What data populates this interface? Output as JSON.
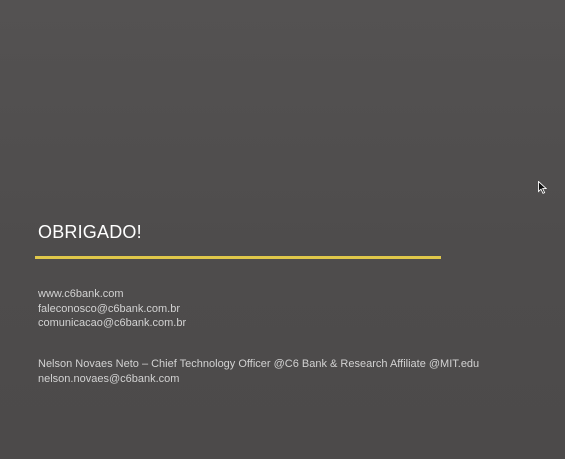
{
  "slide": {
    "title": "OBRIGADO!",
    "contacts": [
      "www.c6bank.com",
      "faleconosco@c6bank.com.br",
      "comunicacao@c6bank.com.br"
    ],
    "signature": {
      "line1": "Nelson Novaes Neto – Chief Technology Officer @C6 Bank & Research Affiliate @MIT.edu",
      "line2": "nelson.novaes@c6bank.com"
    }
  },
  "colors": {
    "background": "#4f4d4d",
    "accent_rule": "#e0c84a",
    "title_text": "#ffffff",
    "body_text": "#d2d2d2"
  },
  "icons": {
    "cursor": "mouse-pointer-icon"
  }
}
